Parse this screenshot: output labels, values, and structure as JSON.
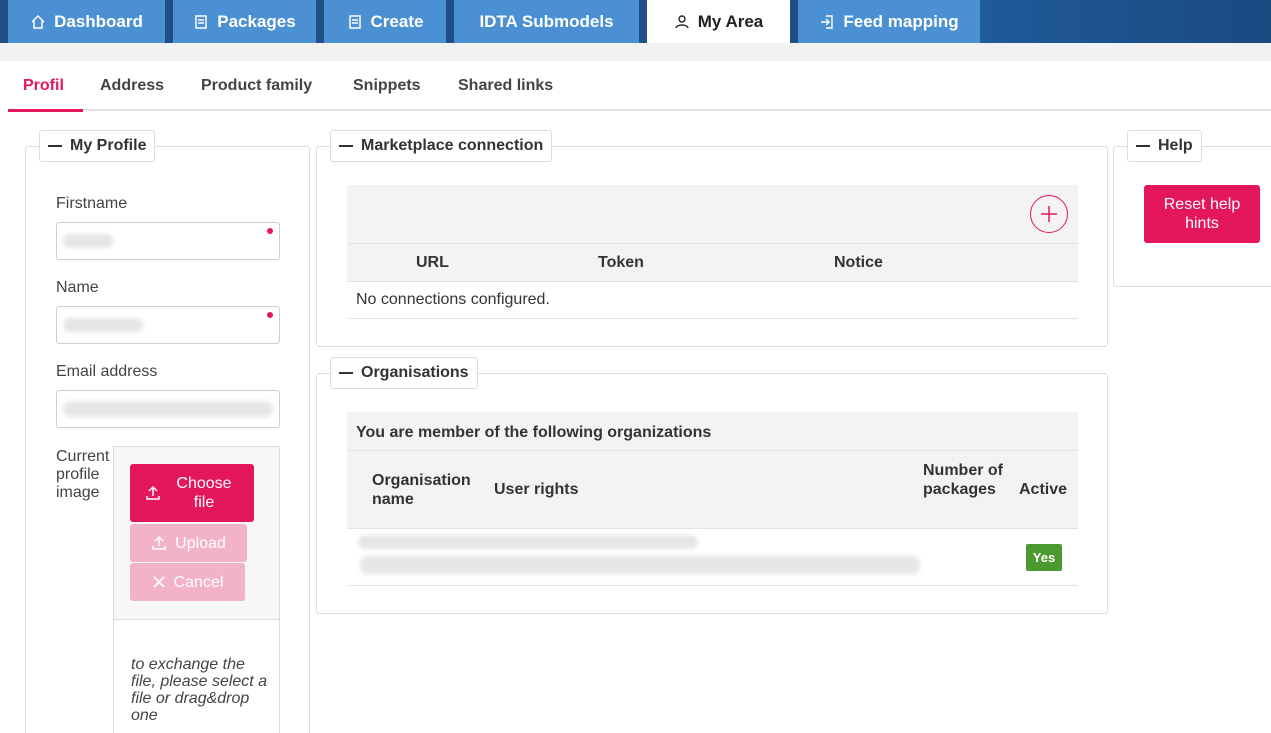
{
  "nav": {
    "tabs": [
      {
        "label": "Dashboard",
        "icon": "home-icon"
      },
      {
        "label": "Packages",
        "icon": "document-icon"
      },
      {
        "label": "Create",
        "icon": "document-icon"
      },
      {
        "label": "IDTA Submodels",
        "icon": ""
      },
      {
        "label": "My Area",
        "icon": "user-icon"
      },
      {
        "label": "Feed mapping",
        "icon": "import-icon"
      }
    ],
    "active": "My Area"
  },
  "subtabs": {
    "items": [
      "Profil",
      "Address",
      "Product family",
      "Snippets",
      "Shared links"
    ],
    "active": "Profil"
  },
  "profile": {
    "legend": "My Profile",
    "firstname_label": "Firstname",
    "name_label": "Name",
    "email_label": "Email address",
    "image_label": "Current profile image",
    "choose_file": "Choose file",
    "upload": "Upload",
    "cancel": "Cancel",
    "hint": "to exchange the file, please select a file or drag&drop one"
  },
  "marketplace": {
    "legend": "Marketplace connection",
    "columns": [
      "URL",
      "Token",
      "Notice"
    ],
    "empty_text": "No connections configured."
  },
  "organisations": {
    "legend": "Organisations",
    "caption": "You are member of the following organizations",
    "columns": [
      "Organisation name",
      "User rights",
      "Number of packages",
      "Active"
    ],
    "rows": [
      {
        "active": "Yes"
      }
    ]
  },
  "help": {
    "legend": "Help",
    "reset_button": "Reset help hints"
  },
  "colors": {
    "accent": "#e4175c",
    "nav_tab": "#4a90d2",
    "nav_bg": "#1f4f86",
    "active_badge": "#4b9a2f"
  }
}
